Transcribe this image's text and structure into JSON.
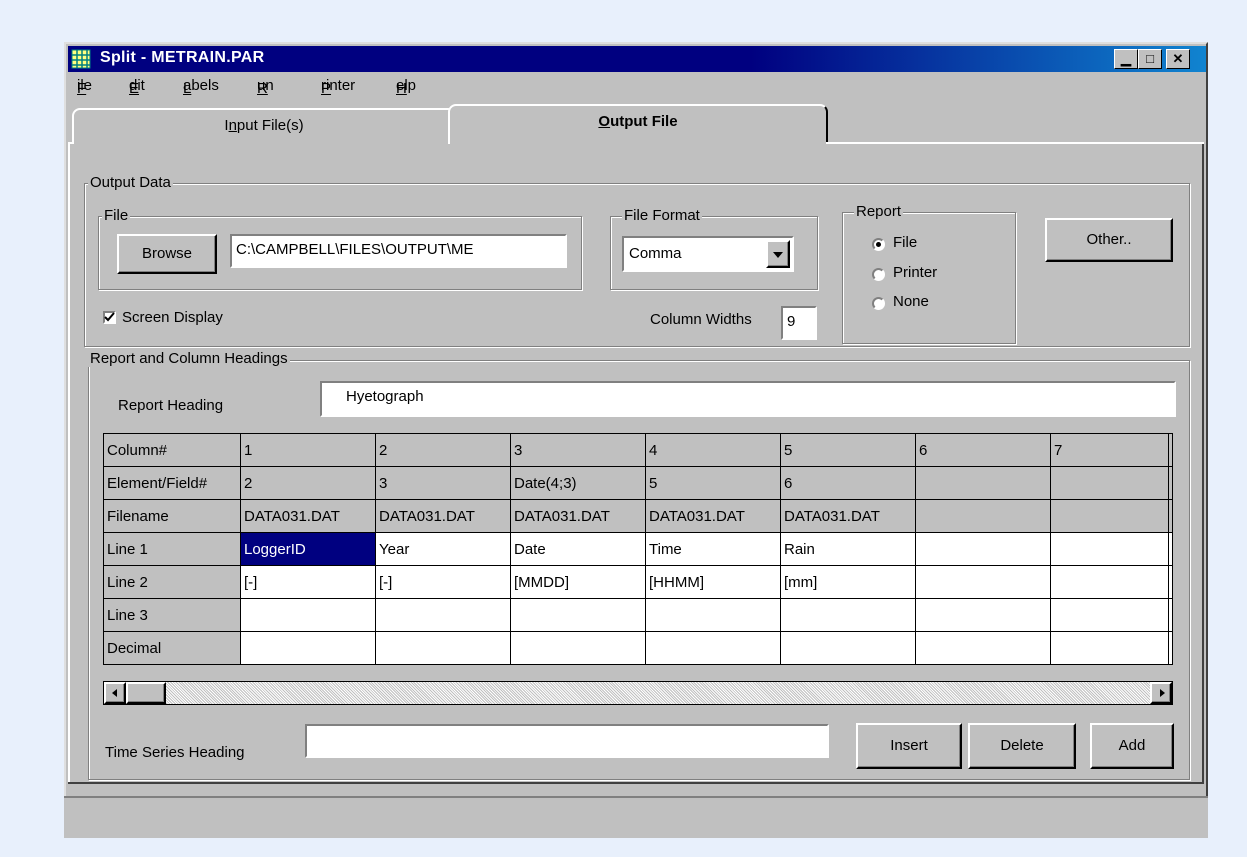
{
  "window": {
    "title": "Split - METRAIN.PAR"
  },
  "menu": [
    "File",
    "Edit",
    "Labels",
    "Run",
    "Printer",
    "Help"
  ],
  "tabs": [
    {
      "label": "Input File(s)",
      "active": false
    },
    {
      "label": "Output File",
      "active": true
    }
  ],
  "output_data": {
    "group_label": "Output Data",
    "file": {
      "group_label": "File",
      "browse_label": "Browse",
      "path": "C:\\CAMPBELL\\FILES\\OUTPUT\\ME"
    },
    "file_format": {
      "group_label": "File Format",
      "value": "Comma"
    },
    "report": {
      "group_label": "Report",
      "options": [
        "File",
        "Printer",
        "None"
      ],
      "selected": "File"
    },
    "other_label": "Other..",
    "screen_display": {
      "label": "Screen Display",
      "checked": true
    },
    "column_widths": {
      "label": "Column Widths",
      "value": "9"
    }
  },
  "headings": {
    "group_label": "Report and Column Headings",
    "report_heading_label": "Report Heading",
    "report_heading_value": "Hyetograph",
    "grid": {
      "rows": [
        {
          "label": "Column#",
          "cells": [
            "1",
            "2",
            "3",
            "4",
            "5",
            "6",
            "7"
          ]
        },
        {
          "label": "Element/Field#",
          "cells": [
            "2",
            "3",
            "Date(4;3)",
            "5",
            "6",
            "",
            ""
          ]
        },
        {
          "label": "Filename",
          "cells": [
            "DATA031.DAT",
            "DATA031.DAT",
            "DATA031.DAT",
            "DATA031.DAT",
            "DATA031.DAT",
            "",
            ""
          ]
        },
        {
          "label": "Line 1",
          "cells": [
            "LoggerID",
            "Year",
            "Date",
            "Time",
            "Rain",
            "",
            ""
          ]
        },
        {
          "label": "Line 2",
          "cells": [
            "[-]",
            "[-]",
            "[MMDD]",
            "[HHMM]",
            "[mm]",
            "",
            ""
          ]
        },
        {
          "label": "Line 3",
          "cells": [
            "",
            "",
            "",
            "",
            "",
            "",
            ""
          ]
        },
        {
          "label": "Decimal",
          "cells": [
            "",
            "",
            "",
            "",
            "",
            "",
            ""
          ]
        }
      ],
      "selected_cell": "LoggerID"
    },
    "time_series_label": "Time Series Heading",
    "time_series_value": "",
    "buttons": {
      "insert": "Insert",
      "delete": "Delete",
      "add": "Add"
    }
  },
  "colors": {
    "title_bar": "#000080",
    "face": "#c0c0c0",
    "selection": "#000080"
  }
}
